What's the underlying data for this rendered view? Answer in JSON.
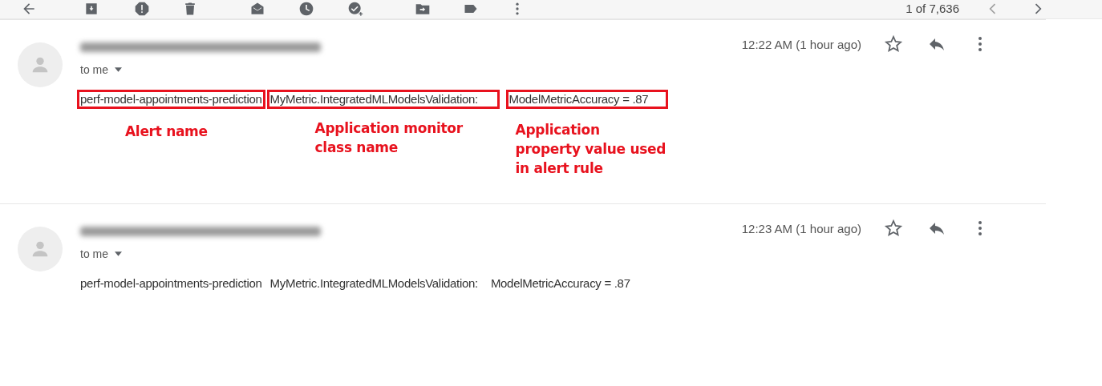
{
  "toolbar": {
    "count": "1 of 7,636",
    "newer_disabled": true
  },
  "messages": [
    {
      "time": "12:22 AM (1 hour ago)",
      "recipient": "to me",
      "starred": false,
      "body_parts": [
        {
          "text": "perf-model-appointments-prediction",
          "highlighted": true,
          "annotation": "Alert name"
        },
        {
          "text": "MyMetric.IntegratedMLModelsValidation:",
          "highlighted": true,
          "annotation": "Application monitor class name"
        },
        {
          "text": "ModelMetricAccuracy = .87",
          "highlighted": true,
          "annotation": "Application property value used in alert rule"
        }
      ]
    },
    {
      "time": "12:23 AM (1 hour ago)",
      "recipient": "to me",
      "starred": false,
      "body_parts": [
        {
          "text": "perf-model-appointments-prediction",
          "highlighted": false
        },
        {
          "text": "MyMetric.IntegratedMLModelsValidation:",
          "highlighted": false
        },
        {
          "text": "ModelMetricAccuracy = .87",
          "highlighted": false
        }
      ]
    }
  ]
}
